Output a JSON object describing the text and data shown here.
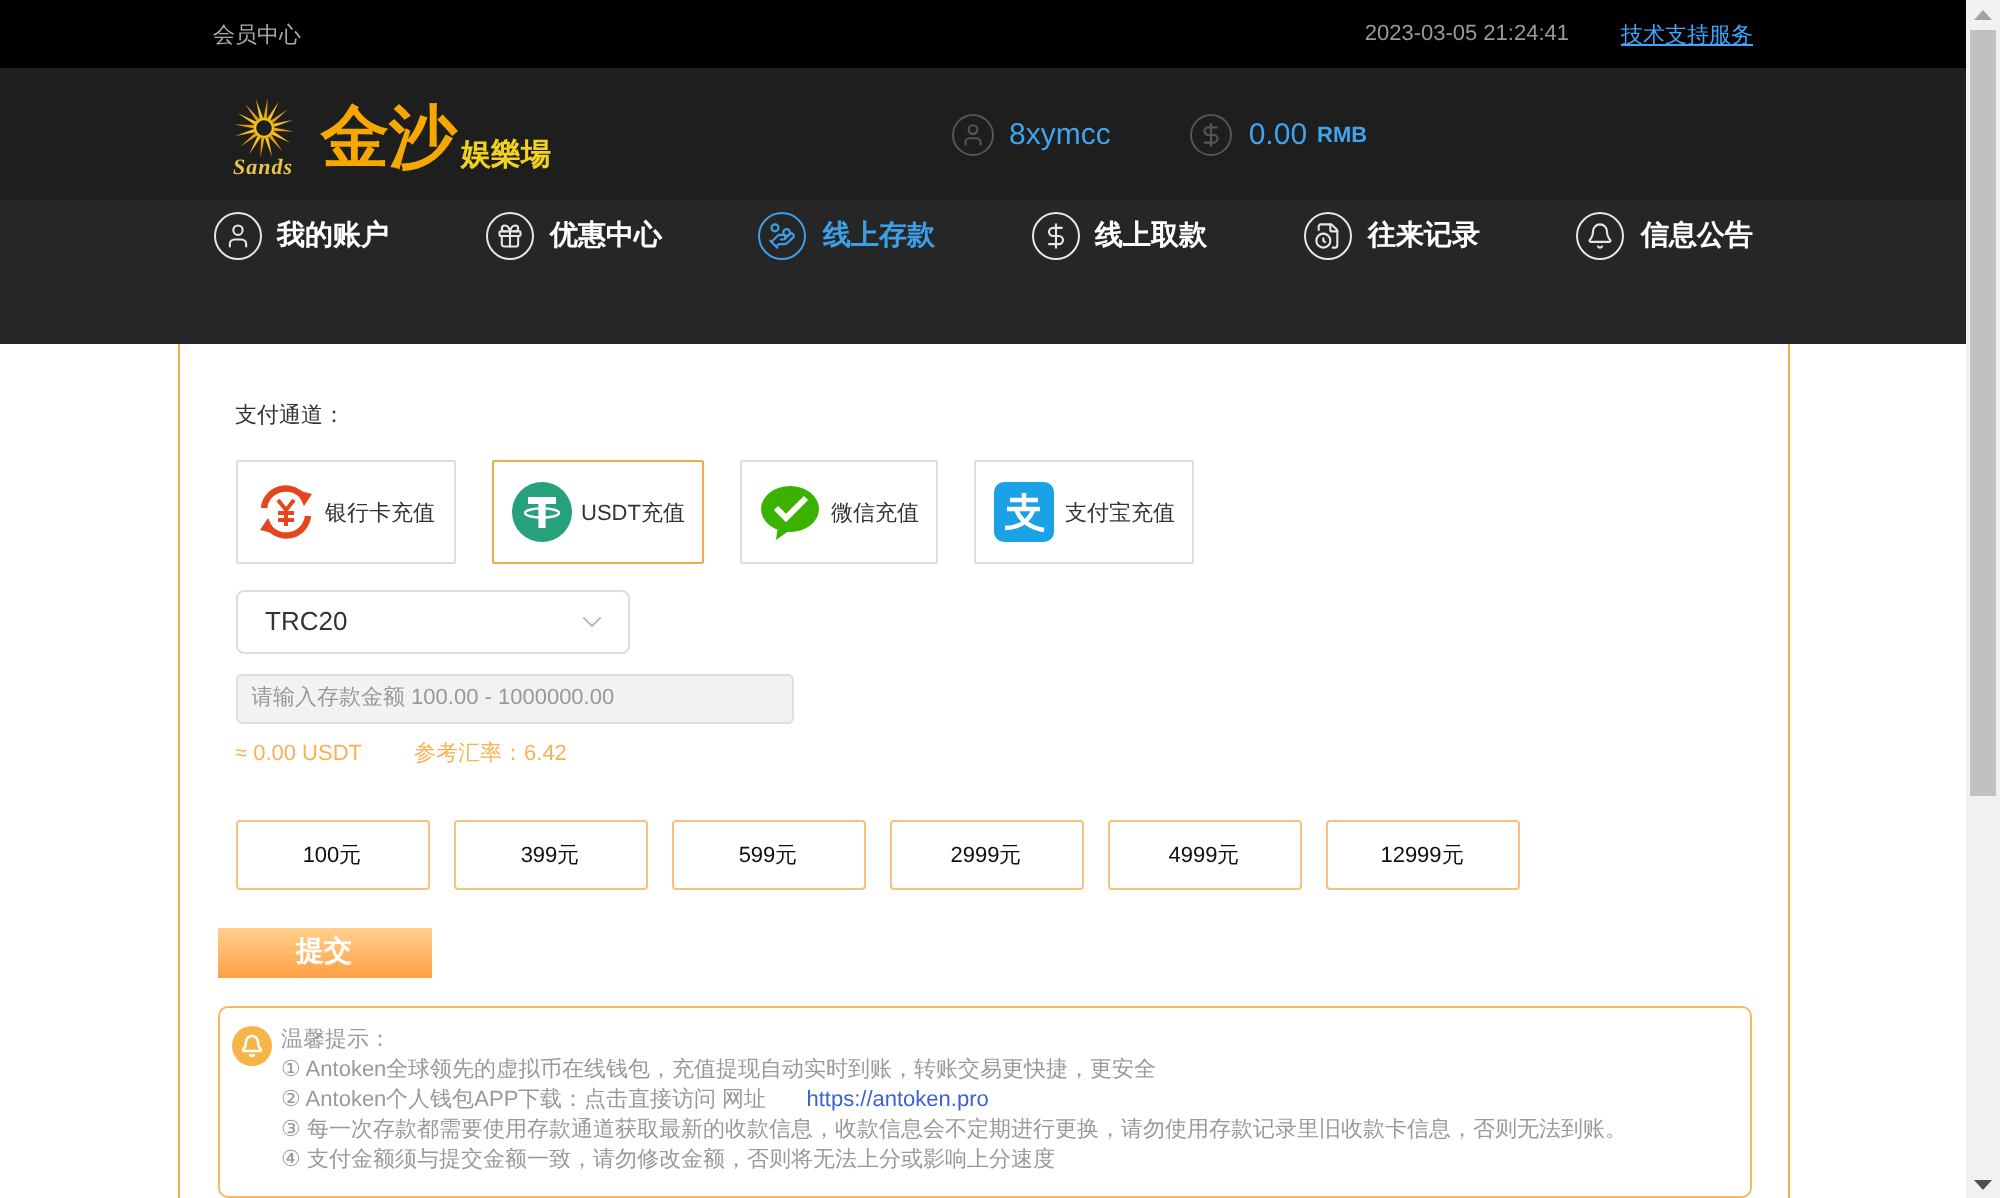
{
  "top_bar": {
    "title": "会员中心",
    "datetime": "2023-03-05 21:24:41",
    "support_link": "技术支持服务"
  },
  "header": {
    "logo": {
      "emblem_text": "Sands",
      "name": "金沙",
      "tagline": "娱樂場"
    },
    "username": "8xymcc",
    "balance": "0.00",
    "currency": "RMB"
  },
  "nav": [
    {
      "label": "我的账户",
      "selected": false
    },
    {
      "label": "优惠中心",
      "selected": false
    },
    {
      "label": "线上存款",
      "selected": true
    },
    {
      "label": "线上取款",
      "selected": false
    },
    {
      "label": "往来记录",
      "selected": false
    },
    {
      "label": "信息公告",
      "selected": false
    }
  ],
  "deposit": {
    "channel_label": "支付通道：",
    "channels": [
      {
        "label": "银行卡充值",
        "selected": false
      },
      {
        "label": "USDT充值",
        "selected": true
      },
      {
        "label": "微信充值",
        "selected": false
      },
      {
        "label": "支付宝充值",
        "selected": false
      }
    ],
    "network": "TRC20",
    "amount_field": {
      "placeholder": "请输入存款金额 100.00 - 1000000.00"
    },
    "converted": "≈ 0.00 USDT",
    "rate": "参考汇率：6.42",
    "quick_amounts": [
      "100元",
      "399元",
      "599元",
      "2999元",
      "4999元",
      "12999元"
    ],
    "submit": "提交"
  },
  "notice": {
    "title": "温馨提示：",
    "lines": [
      {
        "text": "① Antoken全球领先的虚拟币在线钱包，充值提现自动实时到账，转账交易更快捷，更安全"
      },
      {
        "text": "② Antoken个人钱包APP下载：点击直接访问 网址",
        "link": "https://antoken.pro"
      },
      {
        "text": "③ 每一次存款都需要使用存款通道获取最新的收款信息，收款信息会不定期进行更换，请勿使用存款记录里旧收款卡信息，否则无法到账。"
      },
      {
        "text": "④ 支付金额须与提交金额一致，请勿修改金额，否则将无法上分或影响上分速度"
      }
    ]
  }
}
